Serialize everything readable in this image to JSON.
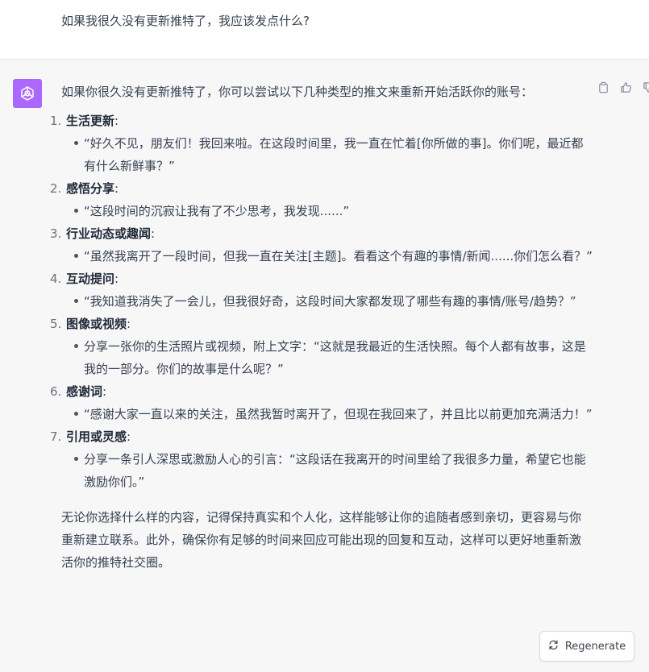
{
  "user_message": {
    "text": "如果我很久没有更新推特了，我应该发点什么?"
  },
  "assistant_message": {
    "intro": "如果你很久没有更新推特了，你可以尝试以下几种类型的推文来重新开始活跃你的账号：",
    "items": [
      {
        "number": "1.",
        "title": "生活更新",
        "colon": ":",
        "bullet": "“好久不见，朋友们！我回来啦。在这段时间里，我一直在忙着[你所做的事]。你们呢，最近都有什么新鲜事？”"
      },
      {
        "number": "2.",
        "title": "感悟分享",
        "colon": ":",
        "bullet": "“这段时间的沉寂让我有了不少思考，我发现......”"
      },
      {
        "number": "3.",
        "title": "行业动态或趣闻",
        "colon": ":",
        "bullet": "“虽然我离开了一段时间，但我一直在关注[主题]。看看这个有趣的事情/新闻......你们怎么看？”"
      },
      {
        "number": "4.",
        "title": "互动提问",
        "colon": ":",
        "bullet": "“我知道我消失了一会儿，但我很好奇，这段时间大家都发现了哪些有趣的事情/账号/趋势？”"
      },
      {
        "number": "5.",
        "title": "图像或视频",
        "colon": ":",
        "bullet": "分享一张你的生活照片或视频，附上文字：“这就是我最近的生活快照。每个人都有故事，这是我的一部分。你们的故事是什么呢？”"
      },
      {
        "number": "6.",
        "title": "感谢词",
        "colon": ":",
        "bullet": "“感谢大家一直以来的关注，虽然我暂时离开了，但现在我回来了，并且比以前更加充满活力！”"
      },
      {
        "number": "7.",
        "title": "引用或灵感",
        "colon": ":",
        "bullet": "分享一条引人深思或激励人心的引言：“这段话在我离开的时间里给了我很多力量，希望它也能激励你们。”"
      }
    ],
    "outro": "无论你选择什么样的内容，记得保持真实和个人化，这样能够让你的追随者感到亲切，更容易与你重新建立联系。此外，确保你有足够的时间来回应可能出现的回复和互动，这样可以更好地重新激活你的推特社交圈。"
  },
  "regenerate_button": {
    "label": "Regenerate"
  },
  "colors": {
    "avatar_bg": "#ab68ff",
    "assistant_bg": "#f7f7f8",
    "user_bg": "#ffffff"
  },
  "icons": [
    "openai-logo-icon",
    "copy-icon",
    "thumbs-up-icon",
    "thumbs-down-icon",
    "refresh-icon"
  ]
}
